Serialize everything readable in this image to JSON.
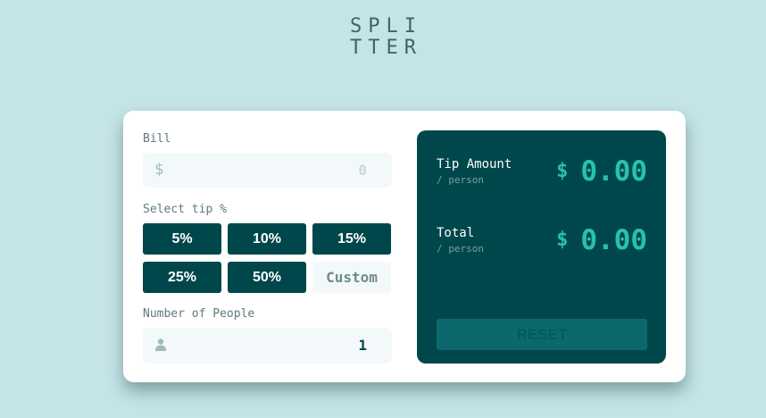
{
  "logo": {
    "line1": "SPLI",
    "line2": "TTER"
  },
  "bill": {
    "label": "Bill",
    "currency_symbol": "$",
    "value": "0"
  },
  "tip": {
    "label": "Select tip %",
    "options": [
      "5%",
      "10%",
      "15%",
      "25%",
      "50%"
    ],
    "custom_placeholder": "Custom"
  },
  "people": {
    "label": "Number of People",
    "value": "1",
    "icon": "person-icon"
  },
  "results": {
    "tip_label": "Tip Amount",
    "tip_sub": "/ person",
    "tip_currency": "$",
    "tip_value": "0.00",
    "total_label": "Total",
    "total_sub": "/ person",
    "total_currency": "$",
    "total_value": "0.00",
    "reset_label": "RESET"
  },
  "colors": {
    "background": "#c5e4e7",
    "primary": "#00474b",
    "accent": "#26c2ae",
    "card": "#ffffff"
  }
}
